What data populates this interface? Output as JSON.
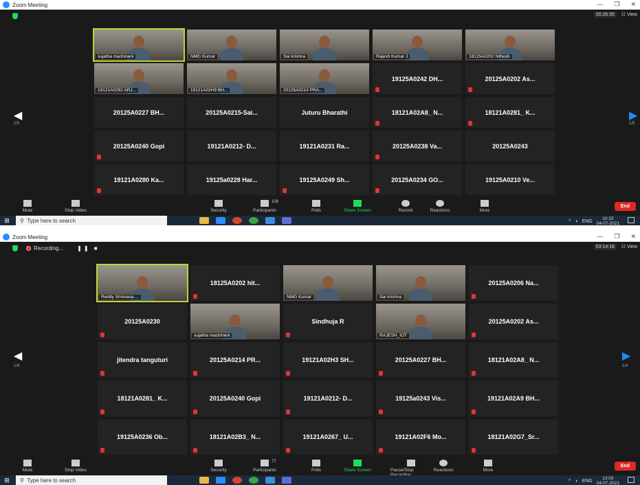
{
  "windows": [
    {
      "title": "Zoom Meeting",
      "recording": null,
      "timer": "00:26:35",
      "view_label": "View",
      "page_left": "1/5",
      "page_right": "1/5",
      "tiles": [
        {
          "label": "sujatha machineni",
          "video": true,
          "active": true,
          "muted": false
        },
        {
          "label": "NMG Kumar",
          "video": true,
          "active": false,
          "muted": false
        },
        {
          "label": "Sai krishna",
          "video": true,
          "active": false,
          "muted": false
        },
        {
          "label": "Rajesh Kumar J",
          "video": true,
          "active": false,
          "muted": true
        },
        {
          "label": "18125A0202 hithesh",
          "video": true,
          "active": false,
          "muted": false
        },
        {
          "label": "19121A0292 ARJ...",
          "video": true,
          "active": false,
          "muted": true
        },
        {
          "label": "19121A02H9 BH...",
          "video": true,
          "active": false,
          "muted": true
        },
        {
          "label": "20125A0214 PRA...",
          "video": true,
          "active": false,
          "muted": true
        },
        {
          "label": "19125A0242 DH...",
          "video": false,
          "active": false,
          "muted": true
        },
        {
          "label": "20125A0202 As...",
          "video": false,
          "active": false,
          "muted": true
        },
        {
          "label": "20125A0227 BH...",
          "video": false,
          "active": false,
          "muted": false
        },
        {
          "label": "20125A0215-Sai...",
          "video": false,
          "active": false,
          "muted": false
        },
        {
          "label": "Juturu Bharathi",
          "video": false,
          "active": false,
          "muted": false
        },
        {
          "label": "18121A02A8_ N...",
          "video": false,
          "active": false,
          "muted": true
        },
        {
          "label": "18121A0281_ K...",
          "video": false,
          "active": false,
          "muted": true
        },
        {
          "label": "20125A0240 Gopi",
          "video": false,
          "active": false,
          "muted": true
        },
        {
          "label": "19121A0212- D...",
          "video": false,
          "active": false,
          "muted": false
        },
        {
          "label": "19121A0231 Ra...",
          "video": false,
          "active": false,
          "muted": false
        },
        {
          "label": "20125A0238 Va...",
          "video": false,
          "active": false,
          "muted": true
        },
        {
          "label": "20125A0243",
          "video": false,
          "active": false,
          "muted": false
        },
        {
          "label": "19121A0280 Ka...",
          "video": false,
          "active": false,
          "muted": true
        },
        {
          "label": "19125a0228 Har...",
          "video": false,
          "active": false,
          "muted": false
        },
        {
          "label": "19125A0249 Sh...",
          "video": false,
          "active": false,
          "muted": true
        },
        {
          "label": "20125A0234 GO...",
          "video": false,
          "active": false,
          "muted": true
        },
        {
          "label": "19125A0210 Ve...",
          "video": false,
          "active": false,
          "muted": false
        }
      ],
      "toolbar": [
        {
          "label": "Mute",
          "icon": "mic-icon"
        },
        {
          "label": "Stop Video",
          "icon": "video-camera-icon"
        },
        {
          "label": "Security",
          "icon": "shield-icon"
        },
        {
          "label": "Participants",
          "icon": "participants-icon",
          "count": "108"
        },
        {
          "label": "Polls",
          "icon": "polls-icon"
        },
        {
          "label": "Share Screen",
          "icon": "share-screen-icon"
        },
        {
          "label": "Record",
          "icon": "record-icon"
        },
        {
          "label": "Reactions",
          "icon": "reactions-icon"
        },
        {
          "label": "More",
          "icon": "more-icon"
        }
      ],
      "end_label": "End",
      "taskbar": {
        "search": "Type here to search",
        "lang": "ENG",
        "time": "10:15",
        "date": "04-07-2021"
      }
    },
    {
      "title": "Zoom Meeting",
      "recording": "Recording...",
      "timer": "03:14:16",
      "view_label": "View",
      "page_left": "1/4",
      "page_right": "1/4",
      "tiles": [
        {
          "label": "Reddy Srinivasa ...",
          "video": true,
          "active": true,
          "muted": false
        },
        {
          "label": "18125A0202 hit...",
          "video": false,
          "active": false,
          "muted": true
        },
        {
          "label": "NMG Kumar",
          "video": true,
          "active": false,
          "muted": false
        },
        {
          "label": "Sai krishna",
          "video": true,
          "active": false,
          "muted": false
        },
        {
          "label": "20125A0206 Na...",
          "video": false,
          "active": false,
          "muted": true
        },
        {
          "label": "20125A0230",
          "video": false,
          "active": false,
          "muted": true
        },
        {
          "label": "sujatha machineni",
          "video": true,
          "active": false,
          "muted": false
        },
        {
          "label": "Sindhuja R",
          "video": false,
          "active": false,
          "muted": true
        },
        {
          "label": "RAJESH_IOT",
          "video": true,
          "active": false,
          "muted": true
        },
        {
          "label": "20125A0202 As...",
          "video": false,
          "active": false,
          "muted": true
        },
        {
          "label": "jitendra tanguturi",
          "video": false,
          "active": false,
          "muted": true
        },
        {
          "label": "20125A0214 PR...",
          "video": false,
          "active": false,
          "muted": true
        },
        {
          "label": "19121A02H3 SH...",
          "video": false,
          "active": false,
          "muted": true
        },
        {
          "label": "20125A0227 BH...",
          "video": false,
          "active": false,
          "muted": true
        },
        {
          "label": "18121A02A8_ N...",
          "video": false,
          "active": false,
          "muted": true
        },
        {
          "label": "18121A0281_ K...",
          "video": false,
          "active": false,
          "muted": true
        },
        {
          "label": "20125A0240 Gopi",
          "video": false,
          "active": false,
          "muted": true
        },
        {
          "label": "19121A0212- D...",
          "video": false,
          "active": false,
          "muted": true
        },
        {
          "label": "19125a0243 Vis...",
          "video": false,
          "active": false,
          "muted": true
        },
        {
          "label": "19121A02A9 BH...",
          "video": false,
          "active": false,
          "muted": true
        },
        {
          "label": "19125A0236 Ob...",
          "video": false,
          "active": false,
          "muted": true
        },
        {
          "label": "18121A02B3_ N...",
          "video": false,
          "active": false,
          "muted": true
        },
        {
          "label": "19121A0267_ U...",
          "video": false,
          "active": false,
          "muted": true
        },
        {
          "label": "19121A02F6 Mo...",
          "video": false,
          "active": false,
          "muted": true
        },
        {
          "label": "18121A02G7_Sr...",
          "video": false,
          "active": false,
          "muted": true
        }
      ],
      "toolbar": [
        {
          "label": "Mute",
          "icon": "mic-icon"
        },
        {
          "label": "Stop Video",
          "icon": "video-camera-icon"
        },
        {
          "label": "Security",
          "icon": "shield-icon"
        },
        {
          "label": "Participants",
          "icon": "participants-icon",
          "count": "77"
        },
        {
          "label": "Polls",
          "icon": "polls-icon"
        },
        {
          "label": "Share Screen",
          "icon": "share-screen-icon"
        },
        {
          "label": "Pause/Stop Recording",
          "icon": "pause-stop-recording-icon"
        },
        {
          "label": "Reactions",
          "icon": "reactions-icon"
        },
        {
          "label": "More",
          "icon": "more-icon"
        }
      ],
      "end_label": "End",
      "taskbar": {
        "search": "Type here to search",
        "lang": "ENG",
        "time": "13:03",
        "date": "04-07-2021"
      }
    }
  ],
  "colors": {
    "accent_green": "#23d959",
    "active_speaker": "#b8d832",
    "end_red": "#e02828",
    "arrow_blue": "#1a8cff"
  }
}
